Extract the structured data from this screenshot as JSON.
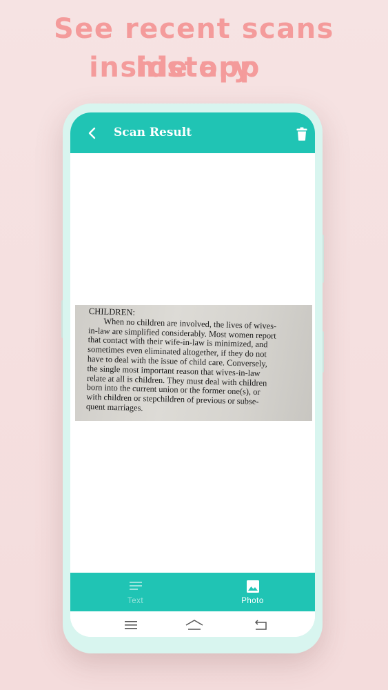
{
  "promo": {
    "line1": "See recent scans history",
    "line2": "inside app",
    "color": "#f49b9b"
  },
  "app_bar": {
    "title": "Scan Result",
    "back_icon": "chevron-left-icon",
    "delete_icon": "trash-icon",
    "color": "#20c4b4"
  },
  "scan": {
    "heading": "CHILDREN:",
    "lines": [
      "When no children are involved, the lives of wives-",
      "in-law are simplified considerably. Most women report",
      "that contact with their wife-in-law is minimized, and",
      "sometimes even eliminated altogether, if they do not",
      "have to deal with the issue of child care. Conversely,",
      "the single most important reason that wives-in-law",
      "relate at all is children. They must deal with children",
      "born into the current union or the former one(s), or",
      "with children or stepchildren of previous or subse-",
      "quent marriages."
    ]
  },
  "bottom_nav": {
    "tabs": [
      {
        "label": "Text",
        "icon": "text-lines-icon",
        "active": false
      },
      {
        "label": "Photo",
        "icon": "image-icon",
        "active": true
      }
    ]
  },
  "system_nav": {
    "icons": [
      "menu-icon",
      "home-icon",
      "back-arrow-icon"
    ]
  }
}
